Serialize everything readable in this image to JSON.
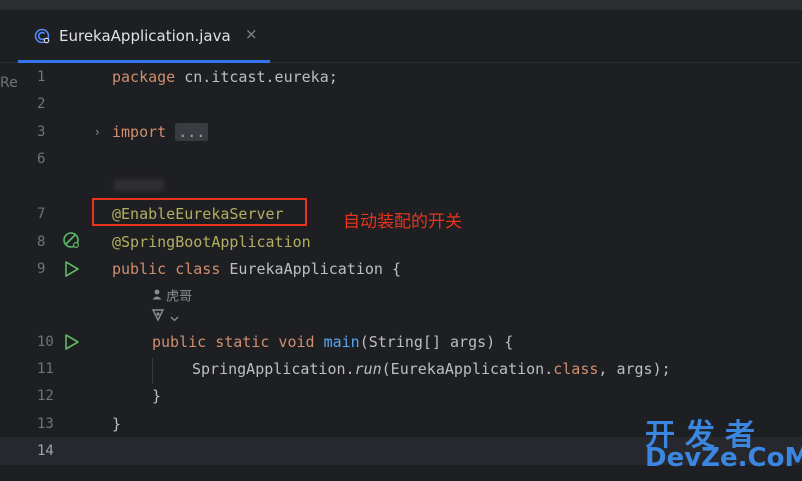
{
  "tab": {
    "filename": "EurekaApplication.java",
    "close_glyph": "×"
  },
  "left_edge_label": "Re",
  "gutter": {
    "line_numbers": [
      "1",
      "2",
      "3",
      "6",
      "7",
      "8",
      "9",
      "10",
      "11",
      "12",
      "13",
      "14"
    ]
  },
  "code": {
    "l1_kw": "package",
    "l1_rest": " cn.itcast.eureka;",
    "l3_kw": "import",
    "l3_fold": "...",
    "l7_ann": "@EnableEurekaServer",
    "l8_ann": "@SpringBootApplication",
    "l9_kw": "public class",
    "l9_rest": " EurekaApplication {",
    "hint_author": "虎哥",
    "l10_kw": "public static void",
    "l10_fn": "main",
    "l10_rest": "(String[] args) {",
    "l11_a": "SpringApplication.",
    "l11_run": "run",
    "l11_b": "(EurekaApplication.",
    "l11_class": "class",
    "l11_c": ", args);",
    "l12": "}",
    "l13": "}"
  },
  "callout": "自动装配的开关",
  "watermark": {
    "line1": "开发者",
    "line2": "DevZe.CoM"
  },
  "colors": {
    "accent": "#3574f0",
    "highlight": "#e8341c",
    "keyword": "#cf8e6d",
    "annotation": "#b3ae60",
    "function": "#56a8f5"
  }
}
